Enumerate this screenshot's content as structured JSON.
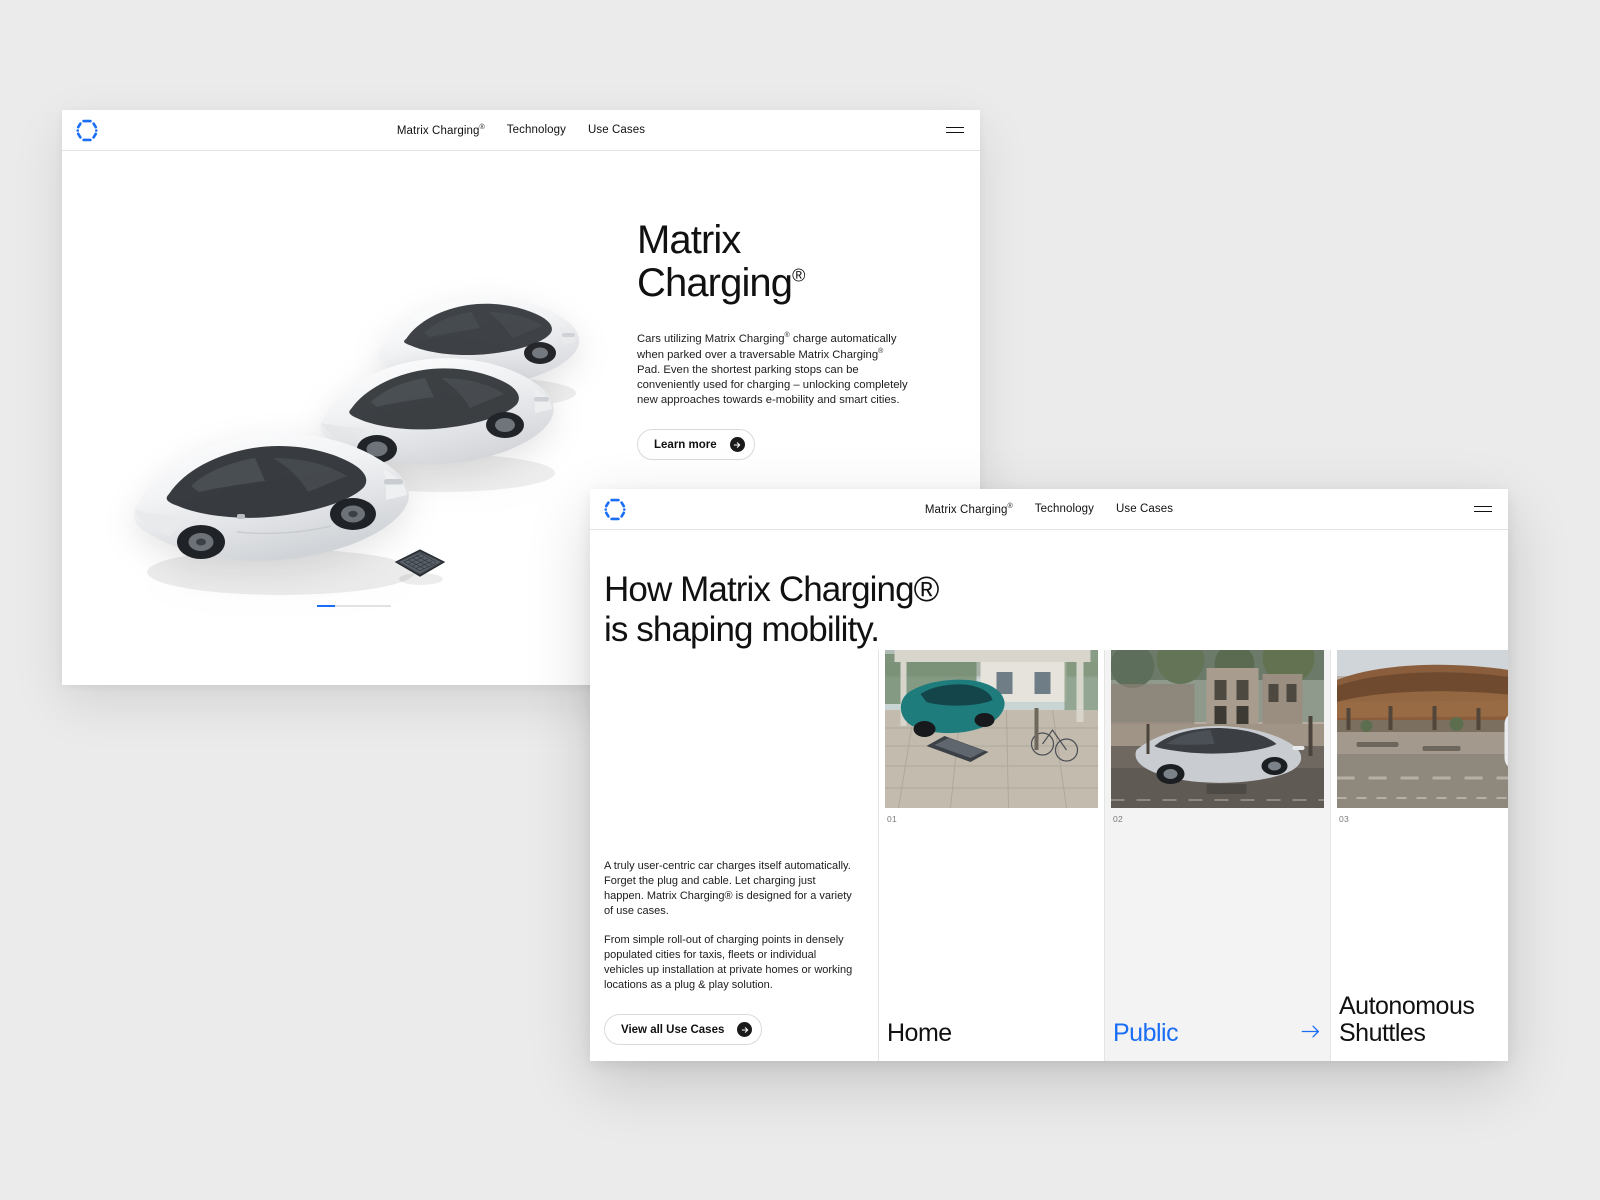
{
  "brand": {
    "accent_blue": "#1a6ef5",
    "logo_name": "matrix-charging-logo",
    "page_bg": "#ebebeb"
  },
  "window_hero": {
    "nav": {
      "links": [
        {
          "label": "Matrix Charging",
          "sup": "®"
        },
        {
          "label": "Technology",
          "sup": ""
        },
        {
          "label": "Use Cases",
          "sup": ""
        }
      ],
      "menu_icon": "hamburger-icon"
    },
    "title_line1": "Matrix",
    "title_line2": "Charging",
    "title_sup": "®",
    "paragraph_parts": {
      "p1": "Cars utilizing Matrix Charging",
      "sup1": "®",
      "p2": " charge automatically when parked over a traversable Matrix Charging",
      "sup2": "®",
      "p3": " Pad. Even the shortest parking stops can be conveniently used for charging – unlocking completely new approaches towards e-mobility and smart cities."
    },
    "cta_label": "Learn more",
    "cta_icon": "arrow-right-circle-icon",
    "slider_progress_percent": 24,
    "visual": {
      "name": "three-white-electric-cars-over-charging-pad",
      "car_count": 3,
      "pad_name": "matrix-charging-pad"
    }
  },
  "window_usecases": {
    "nav": {
      "links": [
        {
          "label": "Matrix Charging",
          "sup": "®"
        },
        {
          "label": "Technology",
          "sup": ""
        },
        {
          "label": "Use Cases",
          "sup": ""
        }
      ],
      "menu_icon": "hamburger-icon"
    },
    "headline_line1": "How Matrix Charging®",
    "headline_line2": "is shaping mobility.",
    "carousel": {
      "prev_icon": "arrow-left-icon",
      "next_icon": "arrow-right-icon",
      "prev_enabled": false,
      "next_enabled": true
    },
    "paragraph_1": "A truly user-centric car charges itself automatically. Forget the plug and cable. Let charging just happen. Matrix Charging® is designed for a variety of use cases.",
    "paragraph_2": "From simple roll-out of charging points in densely populated cities for taxis, fleets or individual vehicles up installation at private homes or working locations as a plug & play solution.",
    "cta_label": "View all Use Cases",
    "cta_icon": "arrow-right-circle-icon",
    "cards": [
      {
        "number": "01",
        "title": "Home",
        "active": false,
        "image_name": "teal-suv-in-carport-with-bicycles"
      },
      {
        "number": "02",
        "title": "Public",
        "active": true,
        "image_name": "silver-suv-parked-on-city-street",
        "arrow_icon": "arrow-right-icon"
      },
      {
        "number": "03",
        "title": "Autonomous Shuttles",
        "active": false,
        "image_name": "autonomous-shuttle-at-transit-hub"
      }
    ]
  }
}
